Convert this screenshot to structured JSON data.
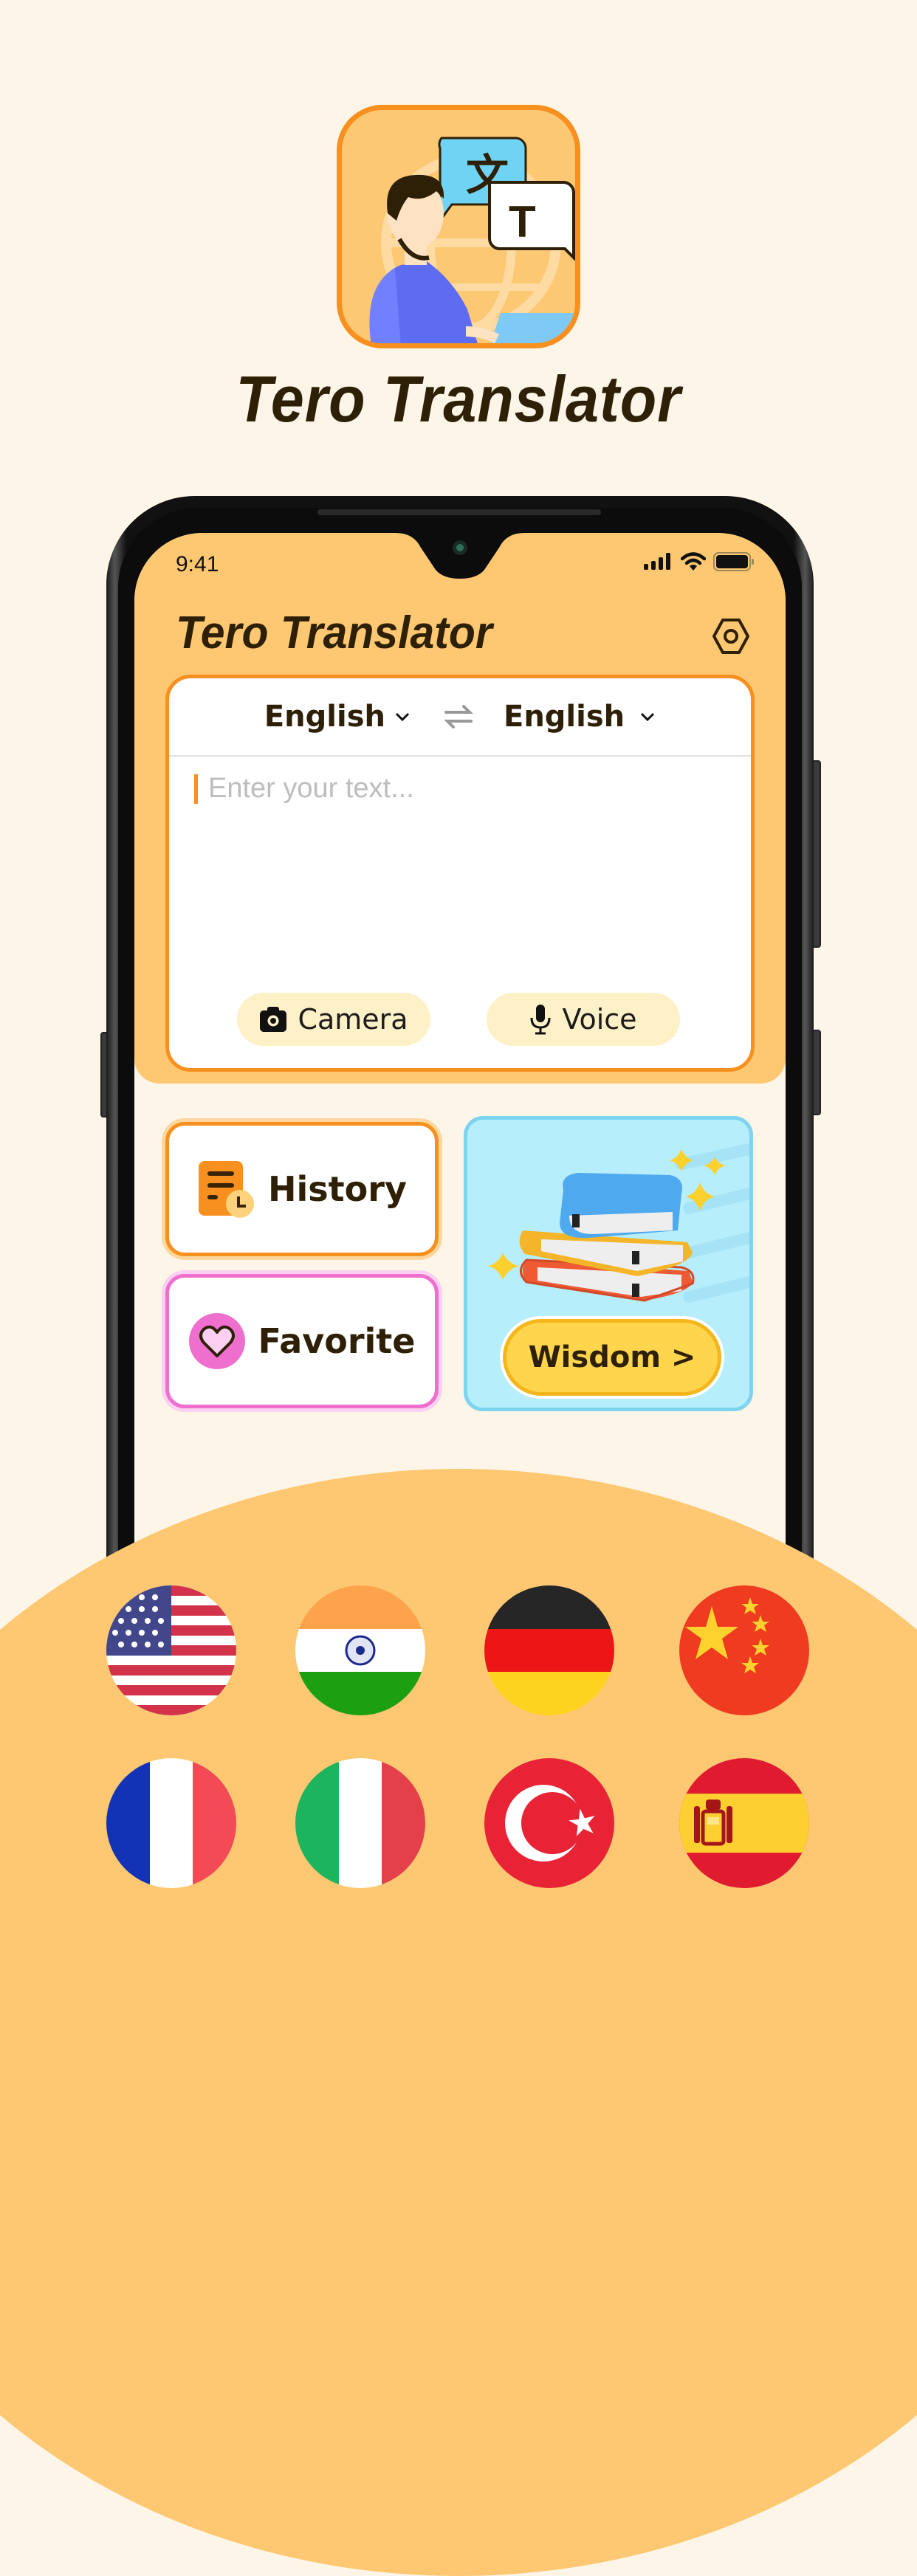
{
  "promo": {
    "app_name": "Tero Translator",
    "icon": "translator-app-icon"
  },
  "status_bar": {
    "time": "9:41",
    "icons": [
      "signal-icon",
      "wifi-icon",
      "battery-icon"
    ]
  },
  "header": {
    "title": "Tero Translator",
    "settings_icon": "settings-hexagon-icon"
  },
  "translator": {
    "source_language": "English",
    "target_language": "English",
    "input": {
      "value": "",
      "placeholder": "Enter your text..."
    },
    "camera_label": "Camera",
    "voice_label": "Voice"
  },
  "tiles": {
    "history_label": "History",
    "favorite_label": "Favorite",
    "wisdom_label": "Wisdom >"
  },
  "flags": [
    {
      "country": "United States",
      "icon": "us-flag-icon"
    },
    {
      "country": "India",
      "icon": "india-flag-icon"
    },
    {
      "country": "Germany",
      "icon": "germany-flag-icon"
    },
    {
      "country": "China",
      "icon": "china-flag-icon"
    },
    {
      "country": "France",
      "icon": "france-flag-icon"
    },
    {
      "country": "Italy",
      "icon": "italy-flag-icon"
    },
    {
      "country": "Turkey",
      "icon": "turkey-flag-icon"
    },
    {
      "country": "Spain",
      "icon": "spain-flag-icon"
    }
  ],
  "colors": {
    "background": "#fdf6e8",
    "accent_orange": "#f7901e",
    "header_yellow": "#fec873",
    "text_dark": "#2e2006",
    "favorite_pink": "#ee6fce",
    "wisdom_blue": "#b7eefc",
    "wisdom_button": "#fed54c"
  }
}
